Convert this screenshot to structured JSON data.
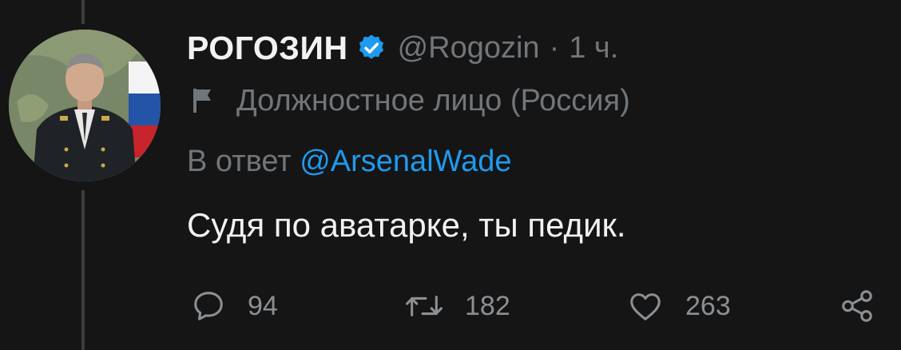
{
  "tweet": {
    "author_name": "РОГОЗИН",
    "handle": "@Rogozin",
    "separator": "·",
    "time": "1 ч.",
    "verified": true,
    "gov_label": "Должностное лицо (Россия)",
    "reply_prefix": "В ответ",
    "reply_mention": "@ArsenalWade",
    "text": "Судя по аватарке, ты педик."
  },
  "actions": {
    "replies": "94",
    "retweets": "182",
    "likes": "263"
  },
  "icons": {
    "verified": "verified-check-icon",
    "gov_label": "flag-icon",
    "reply": "speech-bubble-icon",
    "retweet": "retweet-arrows-icon",
    "like": "heart-icon",
    "share": "share-nodes-icon"
  },
  "colors": {
    "background": "#151515",
    "text_primary": "#f2f2f2",
    "text_secondary": "#71767b",
    "accent": "#1d9bf0",
    "thread_line": "#3a3d41"
  }
}
